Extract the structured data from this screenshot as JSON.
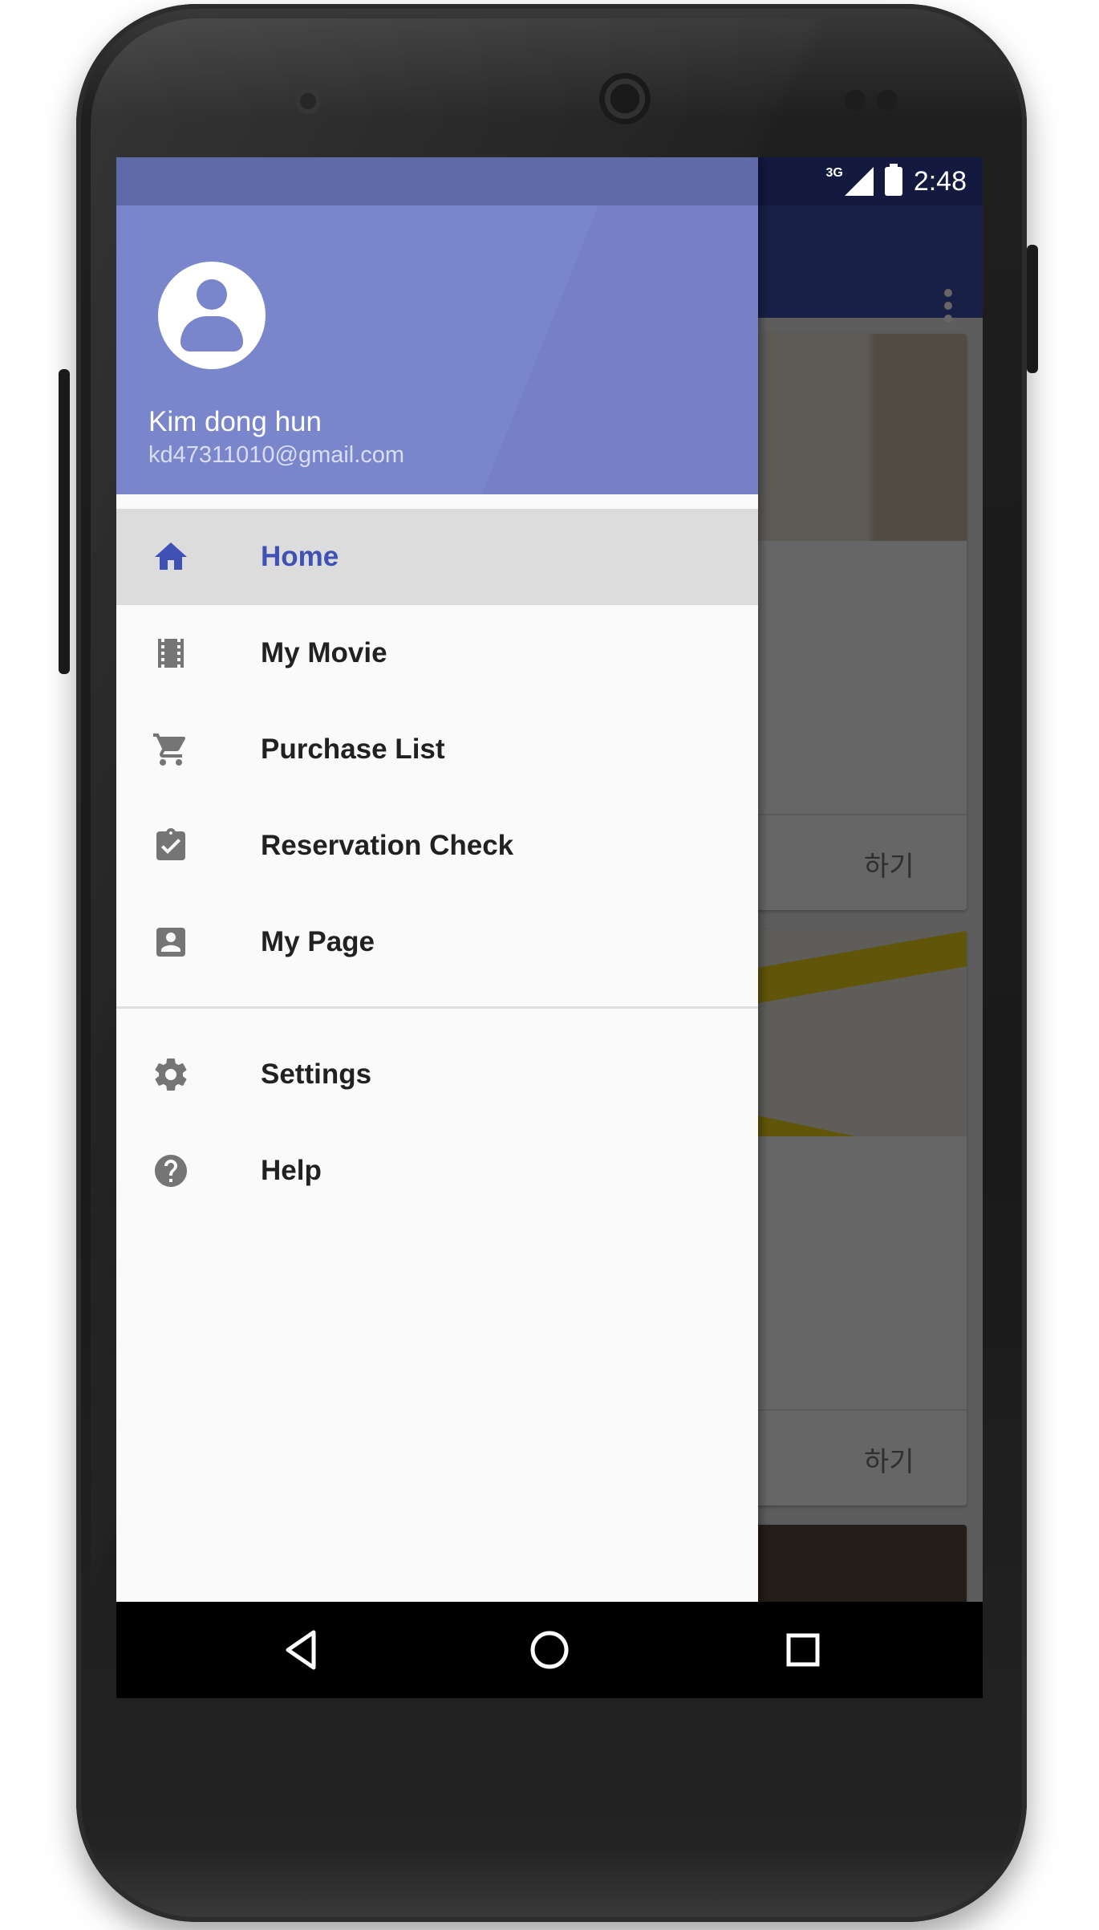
{
  "status_bar": {
    "network": "3G",
    "time": "2:48"
  },
  "drawer": {
    "header": {
      "name": "Kim dong hun",
      "email": "kd47311010@gmail.com"
    },
    "primary_items": [
      {
        "label": "Home",
        "icon": "home-icon",
        "active": true
      },
      {
        "label": "My Movie",
        "icon": "movie-icon",
        "active": false
      },
      {
        "label": "Purchase List",
        "icon": "cart-icon",
        "active": false
      },
      {
        "label": "Reservation Check",
        "icon": "clipboard-check-icon",
        "active": false
      },
      {
        "label": "My Page",
        "icon": "account-box-icon",
        "active": false
      }
    ],
    "secondary_items": [
      {
        "label": "Settings",
        "icon": "gear-icon"
      },
      {
        "label": "Help",
        "icon": "help-icon"
      }
    ]
  },
  "background": {
    "cards": [
      {
        "action_label": "하기"
      },
      {
        "action_label": "하기"
      }
    ]
  },
  "colors": {
    "primary": "#3f51b5",
    "primary_dark": "#303f9f",
    "header": "#7986cb",
    "active_item_bg": "#dcdcdc"
  }
}
